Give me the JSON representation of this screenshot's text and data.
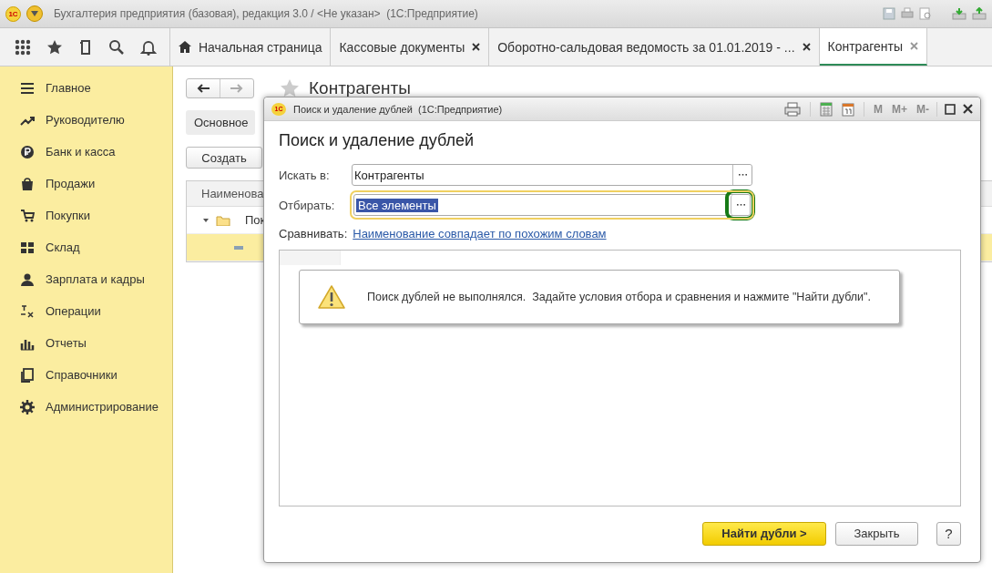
{
  "window": {
    "logo": "1С",
    "title": "Бухгалтерия предприятия (базовая), редакция 3.0 / <Не указан>  (1С:Предприятие)"
  },
  "tabs": [
    {
      "label": "Начальная страница",
      "kind": "home",
      "selected": false
    },
    {
      "label": "Кассовые документы",
      "kind": "closable",
      "selected": false
    },
    {
      "label": "Оборотно-сальдовая ведомость за 01.01.2019 - ...",
      "kind": "closable",
      "selected": false
    },
    {
      "label": "Контрагенты",
      "kind": "closable",
      "selected": true
    }
  ],
  "sidebar": {
    "items": [
      "Главное",
      "Руководителю",
      "Банк и касса",
      "Продажи",
      "Покупки",
      "Склад",
      "Зарплата и кадры",
      "Операции",
      "Отчеты",
      "Справочники",
      "Администрирование"
    ]
  },
  "form": {
    "title": "Контрагенты",
    "section_button": "Основное",
    "create_button": "Создать",
    "columns": [
      "Наименова"
    ],
    "rows": [
      {
        "kind": "group",
        "text": "Пок",
        "selected": false
      },
      {
        "kind": "item",
        "selected": true
      }
    ]
  },
  "dialog": {
    "logo": "1С",
    "title": "Поиск и удаление дублей  (1С:Предприятие)",
    "toolbar": [
      "M",
      "M+",
      "M-"
    ],
    "heading": "Поиск и удаление дублей",
    "fields": [
      {
        "label": "Искать в:",
        "value": "Контрагенты",
        "focused": false,
        "highlighted": false
      },
      {
        "label": "Отбирать:",
        "value": "Все элементы",
        "focused": true,
        "highlighted": true
      }
    ],
    "compare": {
      "label": "Сравнивать:",
      "link": "Наименование совпадает по похожим словам"
    },
    "message": "Поиск дублей не выполнялся.  Задайте условия отбора и сравнения и нажмите \"Найти дубли\".",
    "buttons": [
      {
        "label": "Найти дубли >",
        "kind": "primary"
      },
      {
        "label": "Закрыть",
        "kind": "normal"
      },
      {
        "label": "?",
        "kind": "help"
      }
    ]
  }
}
